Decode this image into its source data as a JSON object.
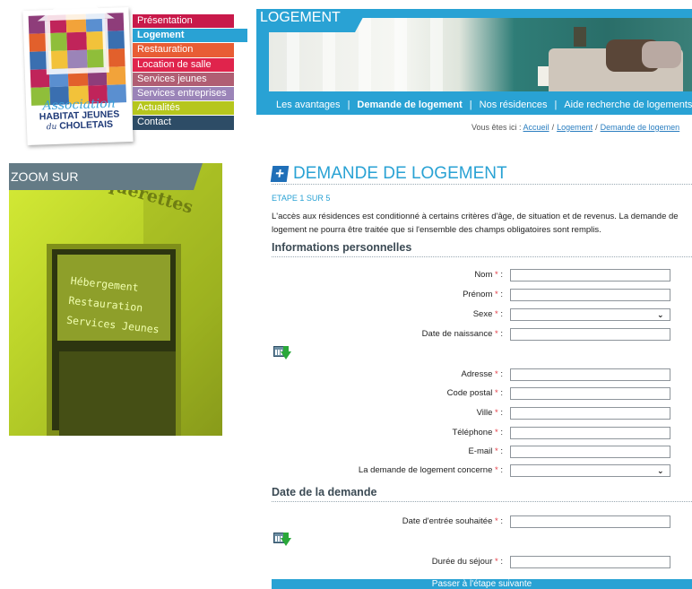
{
  "logo": {
    "line1": "Association",
    "line2": "HABITAT JEUNES",
    "line3_prefix": "du",
    "line3": "CHOLETAIS"
  },
  "menu": {
    "items": [
      {
        "label": "Présentation",
        "color": "#c8194a"
      },
      {
        "label": "Logement",
        "color": "#29a2d4",
        "active": true
      },
      {
        "label": "Restauration",
        "color": "#e85d34"
      },
      {
        "label": "Location de salle",
        "color": "#e0244c"
      },
      {
        "label": "Services jeunes",
        "color": "#b05e73"
      },
      {
        "label": "Services entreprises",
        "color": "#9b84b8"
      },
      {
        "label": "Actualités",
        "color": "#b6c61d"
      },
      {
        "label": "Contact",
        "color": "#2d4c66"
      }
    ]
  },
  "banner": {
    "title": "LOGEMENT",
    "subnav": [
      "Les avantages",
      "Demande de logement",
      "Nos résidences",
      "Aide recherche de logements"
    ],
    "current_index": 1
  },
  "breadcrumb": {
    "prefix": "Vous êtes ici :",
    "items": [
      "Accueil",
      "Logement",
      "Demande de logemen"
    ]
  },
  "zoom": {
    "title": "ZOOM SUR",
    "sign": "es Pâquerettes",
    "lines": [
      "Hébergement",
      "Restauration",
      "Services Jeunes"
    ]
  },
  "main": {
    "title": "DEMANDE DE LOGEMENT",
    "step": "ETAPE 1 SUR 5",
    "intro": "L'accès aux résidences est conditionné à certains critères d'âge, de situation et de revenus. La demande de logement ne pourra être traitée que si l'ensemble des champs obligatoires sont remplis.",
    "section1": "Informations personnelles",
    "section2": "Date de la demande",
    "required_mark": "*",
    "fields": {
      "nom": "Nom",
      "prenom": "Prénom",
      "sexe": "Sexe",
      "naissance": "Date de naissance",
      "adresse": "Adresse",
      "cp": "Code postal",
      "ville": "Ville",
      "tel": "Téléphone",
      "email": "E-mail",
      "concerne": "La demande de logement concerne",
      "entree": "Date d'entrée souhaitée",
      "duree": "Durée du séjour"
    },
    "submit": "Passer à l'étape suivante"
  }
}
